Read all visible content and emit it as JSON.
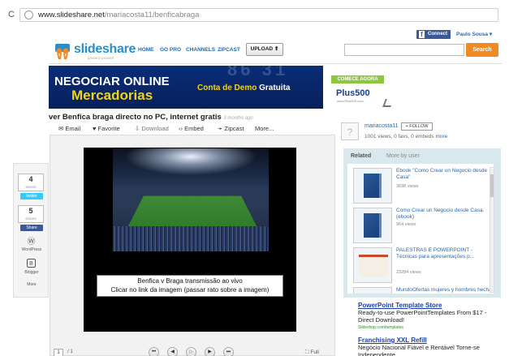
{
  "browser": {
    "reload_icon": "reload-icon",
    "url_host": "www.slideshare.net",
    "url_path": "/mariacosta11/benficabraga"
  },
  "header": {
    "connect_label": "Connect",
    "user_name": "Paulo Sousa",
    "logo": "slideshare",
    "tagline": "present yourself",
    "nav": [
      "HOME",
      "GO PRO",
      "CHANNELS",
      "ZIPCAST"
    ],
    "upload_label": "UPLOAD",
    "search_value": "",
    "search_label": "Search"
  },
  "ad_banner": {
    "digits": "86 31",
    "line1": "NEGOCIAR ONLINE",
    "line2": "Mercadorias",
    "line3_a": "Conta de Demo",
    "line3_b": "Gratuita",
    "cta": "COMECE AGORA",
    "brand": "Plus500",
    "brand_url": "www.Plus500.com"
  },
  "document": {
    "title": "ver Benfica braga directo no PC, internet gratis",
    "ago": "3 months ago",
    "toolbar": [
      "Email",
      "Favorite",
      "Download",
      "Embed",
      "Zipcast",
      "More..."
    ],
    "caption1": "Benfica v Braga transmissão ao vivo",
    "caption2": "Clicar no link da imagem (passar rato sobre a imagem)",
    "page_current": "1",
    "page_total": "/ 1",
    "fullscreen_label": "Full"
  },
  "share": {
    "tweets_count": "4",
    "tweets_label": "tweets",
    "twitter_label": "twitter",
    "shares_count": "5",
    "shares_label": "shares",
    "facebook_label": "Share",
    "wordpress_label": "WordPress",
    "blogger_label": "Blogger",
    "more_label": "More"
  },
  "uploader": {
    "name": "mariacosta11",
    "follow_label": "+ FOLLOW",
    "stats": "1001 views, 0 favs, 0 embeds",
    "more": "more"
  },
  "related": {
    "tab_related": "Related",
    "tab_by_user": "More by user",
    "items": [
      {
        "title": "Ebook \"Como Crear un Negocio desde Casa\"",
        "views": "3698 views"
      },
      {
        "title": "Como Crear un Negocio desde Casa. (ebook)",
        "views": "964 views"
      },
      {
        "title": "PALESTRAS E POWERPOINT - Técnicas para apresentações p...",
        "views": "23284 views"
      },
      {
        "title": "MundoOfertas mujeres y hombres hecha digital Febrero",
        "views": ""
      }
    ]
  },
  "text_ads": [
    {
      "title": "PowerPoint Template Store",
      "body": "Ready-to-use PowerPointTemplates From $17 - Direct Download!",
      "url": "Slideshop.com/templates"
    },
    {
      "title": "Franchising XXL Refill",
      "body": "Negócio Nacional Fiável e Rentável Torne-se Independente",
      "url": ""
    }
  ]
}
